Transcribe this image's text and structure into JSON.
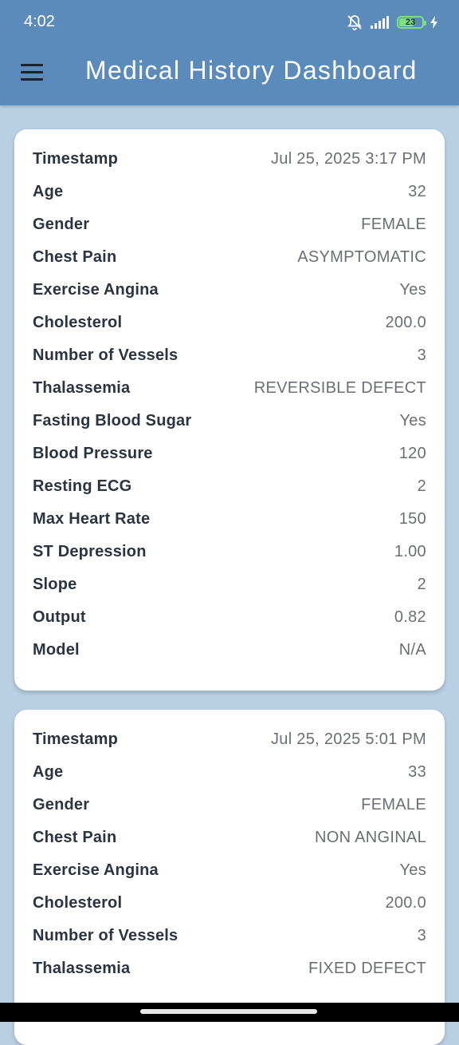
{
  "status_bar": {
    "time": "4:02",
    "battery_level": "23"
  },
  "app_bar": {
    "title": "Medical History Dashboard"
  },
  "records": [
    {
      "rows": [
        {
          "label": "Timestamp",
          "value": "Jul 25, 2025 3:17 PM"
        },
        {
          "label": "Age",
          "value": "32"
        },
        {
          "label": "Gender",
          "value": "FEMALE"
        },
        {
          "label": "Chest Pain",
          "value": "ASYMPTOMATIC"
        },
        {
          "label": "Exercise Angina",
          "value": "Yes"
        },
        {
          "label": "Cholesterol",
          "value": "200.0"
        },
        {
          "label": "Number of Vessels",
          "value": "3"
        },
        {
          "label": "Thalassemia",
          "value": "REVERSIBLE DEFECT"
        },
        {
          "label": "Fasting Blood Sugar",
          "value": "Yes"
        },
        {
          "label": "Blood Pressure",
          "value": "120"
        },
        {
          "label": "Resting ECG",
          "value": "2"
        },
        {
          "label": "Max Heart Rate",
          "value": "150"
        },
        {
          "label": "ST Depression",
          "value": "1.00"
        },
        {
          "label": "Slope",
          "value": "2"
        },
        {
          "label": "Output",
          "value": "0.82"
        },
        {
          "label": "Model",
          "value": "N/A"
        }
      ]
    },
    {
      "rows": [
        {
          "label": "Timestamp",
          "value": "Jul 25, 2025 5:01 PM"
        },
        {
          "label": "Age",
          "value": "33"
        },
        {
          "label": "Gender",
          "value": "FEMALE"
        },
        {
          "label": "Chest Pain",
          "value": "NON ANGINAL"
        },
        {
          "label": "Exercise Angina",
          "value": "Yes"
        },
        {
          "label": "Cholesterol",
          "value": "200.0"
        },
        {
          "label": "Number of Vessels",
          "value": "3"
        },
        {
          "label": "Thalassemia",
          "value": "FIXED DEFECT"
        }
      ]
    }
  ]
}
